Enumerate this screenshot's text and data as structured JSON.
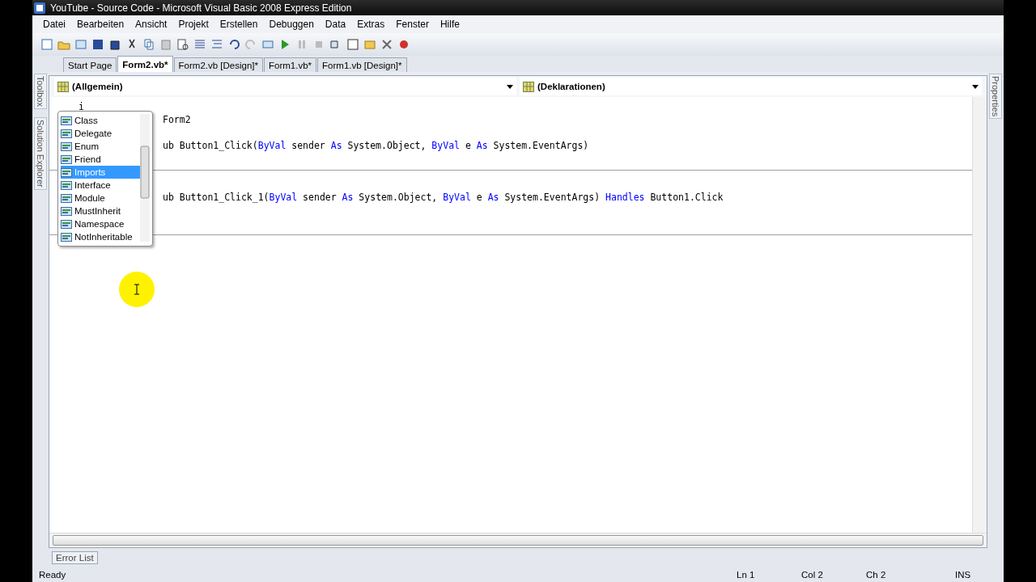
{
  "window": {
    "title": "YouTube - Source Code - Microsoft Visual Basic 2008 Express Edition"
  },
  "menu": [
    "Datei",
    "Bearbeiten",
    "Ansicht",
    "Projekt",
    "Erstellen",
    "Debuggen",
    "Data",
    "Extras",
    "Fenster",
    "Hilfe"
  ],
  "tabs": [
    {
      "label": "Start Page",
      "selected": false
    },
    {
      "label": "Form2.vb*",
      "selected": true
    },
    {
      "label": "Form2.vb [Design]*",
      "selected": false
    },
    {
      "label": "Form1.vb*",
      "selected": false
    },
    {
      "label": "Form1.vb [Design]*",
      "selected": false
    }
  ],
  "side_panels_left": [
    "Toolbox",
    "Solution Explorer"
  ],
  "side_panels_right": [
    "Properties"
  ],
  "dropdowns": [
    {
      "value": "(Allgemein)"
    },
    {
      "value": "(Deklarationen)"
    }
  ],
  "code": [
    {
      "kind": "typed",
      "tokens": [
        {
          "text": "i",
          "keyword": false
        }
      ]
    },
    {
      "kind": "partial",
      "tokens": [
        {
          "text": "Form2",
          "keyword": false
        }
      ]
    },
    {
      "kind": "blank"
    },
    {
      "kind": "partial",
      "tokens": [
        {
          "text": "ub Button1_Click(",
          "keyword": false
        },
        {
          "text": "ByVal",
          "keyword": true
        },
        {
          "text": " sender ",
          "keyword": false
        },
        {
          "text": "As",
          "keyword": true
        },
        {
          "text": " System.Object, ",
          "keyword": false
        },
        {
          "text": "ByVal",
          "keyword": true
        },
        {
          "text": " e ",
          "keyword": false
        },
        {
          "text": "As",
          "keyword": true
        },
        {
          "text": " System.EventArgs)",
          "keyword": false
        }
      ]
    },
    {
      "kind": "blank"
    },
    {
      "kind": "divider"
    },
    {
      "kind": "blank"
    },
    {
      "kind": "partial",
      "tokens": [
        {
          "text": "ub Button1_Click_1(",
          "keyword": false
        },
        {
          "text": "ByVal",
          "keyword": true
        },
        {
          "text": " sender ",
          "keyword": false
        },
        {
          "text": "As",
          "keyword": true
        },
        {
          "text": " System.Object, ",
          "keyword": false
        },
        {
          "text": "ByVal",
          "keyword": true
        },
        {
          "text": " e ",
          "keyword": false
        },
        {
          "text": "As",
          "keyword": true
        },
        {
          "text": " System.EventArgs) ",
          "keyword": false
        },
        {
          "text": "Handles",
          "keyword": true
        },
        {
          "text": " Button1.Click",
          "keyword": false
        }
      ]
    },
    {
      "kind": "blank"
    },
    {
      "kind": "blank"
    },
    {
      "kind": "divider"
    }
  ],
  "completion": [
    {
      "label": "Class",
      "selected": false
    },
    {
      "label": "Delegate",
      "selected": false
    },
    {
      "label": "Enum",
      "selected": false
    },
    {
      "label": "Friend",
      "selected": false
    },
    {
      "label": "Imports",
      "selected": true
    },
    {
      "label": "Interface",
      "selected": false
    },
    {
      "label": "Module",
      "selected": false
    },
    {
      "label": "MustInherit",
      "selected": false
    },
    {
      "label": "Namespace",
      "selected": false
    },
    {
      "label": "NotInheritable",
      "selected": false
    }
  ],
  "bottom_tabs": [
    "Error List"
  ],
  "status_bar": {
    "message": "Ready",
    "line": "Ln 1",
    "column": "Col 2",
    "char": "Ch 2",
    "mode": "INS"
  }
}
